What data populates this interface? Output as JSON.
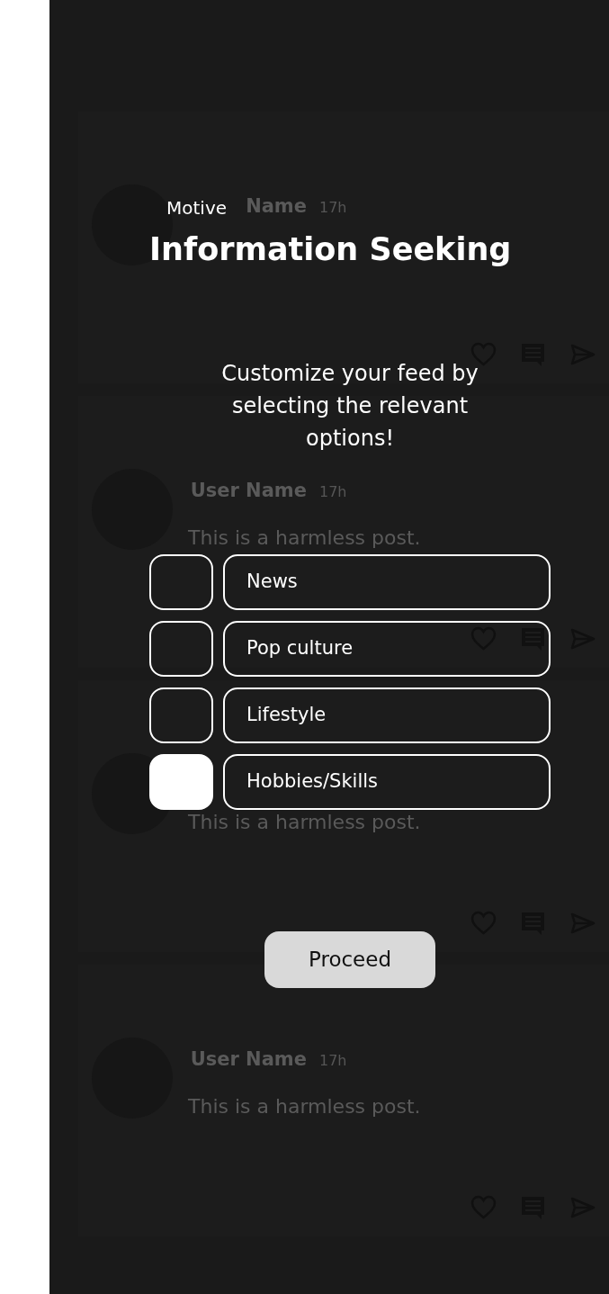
{
  "posts": [
    {
      "user_name": "Name",
      "time": "17h"
    },
    {
      "user_name": "User Name",
      "time": "17h",
      "text": "This is a harmless post."
    },
    {
      "text": "This is a harmless post."
    },
    {
      "user_name": "User Name",
      "time": "17h",
      "text": "This is a harmless post."
    }
  ],
  "overlay": {
    "eyebrow": "Motive",
    "title": "Information Seeking",
    "instruction": "Customize your feed by selecting the relevant options!",
    "options": [
      {
        "label": "News",
        "checked": false
      },
      {
        "label": "Pop culture",
        "checked": false
      },
      {
        "label": "Lifestyle",
        "checked": false
      },
      {
        "label": "Hobbies/Skills",
        "checked": true
      }
    ],
    "button": "Proceed"
  }
}
